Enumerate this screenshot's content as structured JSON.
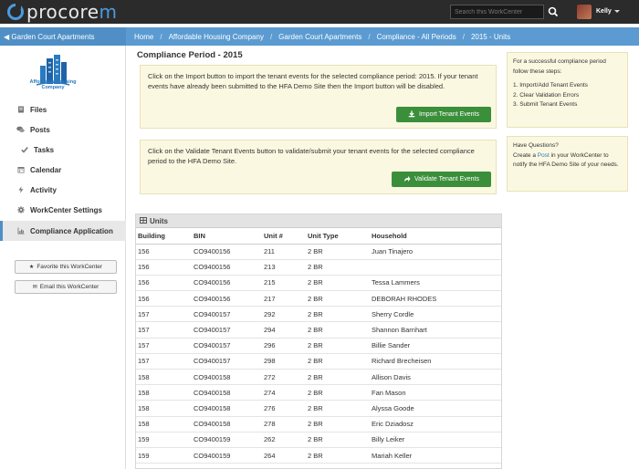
{
  "app": {
    "logo_text_a": "procore",
    "logo_text_b": "m"
  },
  "topbar": {
    "search_placeholder": "Search this WorkCenter",
    "user_name": "Kelly"
  },
  "project": {
    "title": "Garden Court Apartments"
  },
  "breadcrumbs": [
    "Home",
    "Affordable Housing Company",
    "Garden Court Apartments",
    "Compliance - All Periods",
    "2015 - Units"
  ],
  "sidebar": {
    "company_caption": "Affordable Housing Company",
    "items": [
      {
        "label": "Files",
        "icon": "files-icon"
      },
      {
        "label": "Posts",
        "icon": "posts-icon"
      },
      {
        "label": "Tasks",
        "icon": "check-icon"
      },
      {
        "label": "Calendar",
        "icon": "calendar-icon"
      },
      {
        "label": "Activity",
        "icon": "activity-icon"
      },
      {
        "label": "WorkCenter Settings",
        "icon": "gear-icon"
      },
      {
        "label": "Compliance Application",
        "icon": "chart-icon"
      }
    ],
    "favorite_label": "Favorite this WorkCenter",
    "email_label": "Email this WorkCenter"
  },
  "main": {
    "title": "Compliance Period - 2015",
    "import_text": "Click on the Import button to import the tenant events for the selected compliance period: 2015. If your tenant events have already been submitted to the HFA Demo Site then the Import button will be disabled.",
    "import_button": "Import Tenant Events",
    "validate_text": "Click on the Validate Tenant Events button to validate/submit your tenant events for the selected compliance period to the HFA Demo Site.",
    "validate_button": "Validate Tenant Events"
  },
  "units": {
    "header": "Units",
    "columns": [
      "Building",
      "BIN",
      "Unit #",
      "Unit Type",
      "Household"
    ],
    "rows": [
      [
        "156",
        "CO9400156",
        "211",
        "2 BR",
        "Juan Tinajero"
      ],
      [
        "156",
        "CO9400156",
        "213",
        "2 BR",
        ""
      ],
      [
        "156",
        "CO9400156",
        "215",
        "2 BR",
        "Tessa Lammers"
      ],
      [
        "156",
        "CO9400156",
        "217",
        "2 BR",
        "DEBORAH RHODES"
      ],
      [
        "157",
        "CO9400157",
        "292",
        "2 BR",
        "Sherry Cordle"
      ],
      [
        "157",
        "CO9400157",
        "294",
        "2 BR",
        "Shannon Barnhart"
      ],
      [
        "157",
        "CO9400157",
        "296",
        "2 BR",
        "Billie Sander"
      ],
      [
        "157",
        "CO9400157",
        "298",
        "2 BR",
        "Richard Brecheisen"
      ],
      [
        "158",
        "CO9400158",
        "272",
        "2 BR",
        "Allison Davis"
      ],
      [
        "158",
        "CO9400158",
        "274",
        "2 BR",
        "Fan Mason"
      ],
      [
        "158",
        "CO9400158",
        "276",
        "2 BR",
        "Alyssa Goode"
      ],
      [
        "158",
        "CO9400158",
        "278",
        "2 BR",
        "Eric Dziadosz"
      ],
      [
        "159",
        "CO9400159",
        "262",
        "2 BR",
        "Billy Leiker"
      ],
      [
        "159",
        "CO9400159",
        "264",
        "2 BR",
        "Mariah Keller"
      ]
    ]
  },
  "right": {
    "steps_intro": "For a successful compliance period follow these steps:",
    "steps": [
      "1. Import/Add Tenant Events",
      "2. Clear Validation Errors",
      "3. Submit Tenant Events"
    ],
    "questions_title": "Have Questions?",
    "questions_a": "Create a ",
    "questions_link": "Post",
    "questions_b": " in your WorkCenter to notify the HFA Demo Site of your needs."
  },
  "colors": {
    "brand_blue": "#5b9bd1",
    "green_button": "#3b8f3b",
    "info_bg": "#fbf8e1"
  }
}
